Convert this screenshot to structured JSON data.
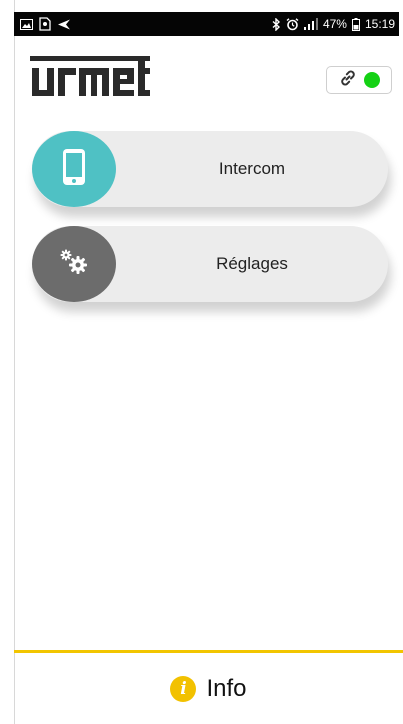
{
  "statusbar": {
    "battery_text": "47%",
    "time": "15:19",
    "icons_left": [
      "gallery-icon",
      "sim-icon",
      "send-icon"
    ],
    "icons_right": [
      "bluetooth-icon",
      "alarm-icon",
      "signal-icon",
      "battery-icon"
    ]
  },
  "header": {
    "logo_text": "urmet",
    "connection_status_color": "#14d114"
  },
  "menu": {
    "items": [
      {
        "label": "Intercom",
        "icon": "smartphone-icon",
        "color": "#4fc1c4"
      },
      {
        "label": "Réglages",
        "icon": "gears-icon",
        "color": "#6c6c6c"
      }
    ]
  },
  "footer": {
    "info_label": "Info",
    "accent_color": "#f2c500"
  }
}
